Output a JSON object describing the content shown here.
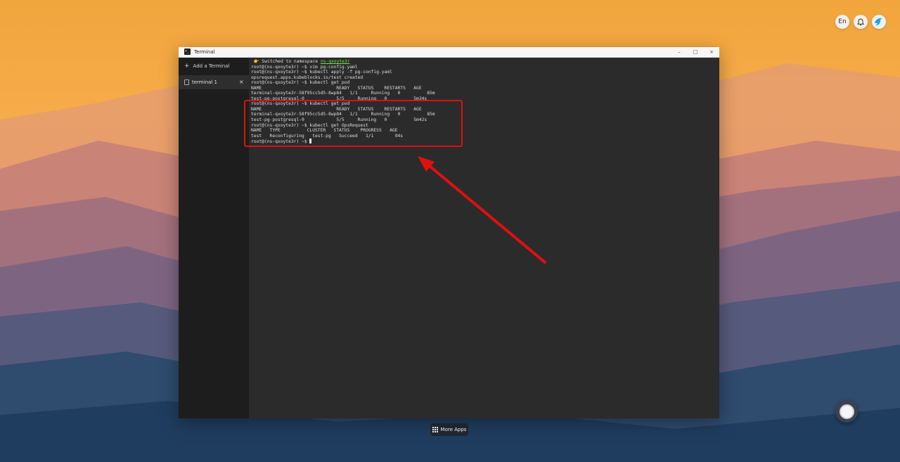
{
  "tray": {
    "language": "En"
  },
  "window": {
    "title": "Terminal",
    "icon_text": ">_",
    "controls": {
      "minimize": "–",
      "maximize": "□",
      "close": "×"
    }
  },
  "sidebar": {
    "add_terminal_label": "Add a Terminal",
    "tabs": [
      {
        "label": "terminal 1",
        "close": "×"
      }
    ]
  },
  "terminal": {
    "switch_prefix": " 👉 Switched to namespace ",
    "namespace": "ns-qxoyte3r",
    "lines": [
      "root@(ns-qxoyte3r) ~$ vim pg-config.yaml",
      "root@(ns-qxoyte3r) ~$ kubectl apply -f pg-config.yaml",
      "opsrequest.apps.kubeblocks.io/test created",
      "root@(ns-qxoyte3r) ~$ kubectl get pod",
      "NAME                            READY   STATUS    RESTARTS   AGE",
      "terminal-qxoyte3r-58f95cc5d5-8wp84   1/1     Running   0          85m",
      "test-pg-postgresql-0            5/5     Running   0          5m34s",
      "root@(ns-qxoyte3r) ~$ kubectl get pod",
      "NAME                            READY   STATUS    RESTARTS   AGE",
      "terminal-qxoyte3r-58f95cc5d5-8wp84   1/1     Running   0          85m",
      "test-pg-postgresql-0            5/5     Running   0          5m42s",
      "root@(ns-qxoyte3r) ~$ kubectl get OpsRequest",
      "NAME   TYPE          CLUSTER   STATUS    PROGRESS   AGE",
      "test   Reconfiguring   test-pg   Succeed   1/1        94s"
    ],
    "prompt": "root@(ns-qxoyte3r) ~$ "
  },
  "dock": {
    "more_apps_label": "More Apps"
  },
  "colors": {
    "annotation": "#e01010",
    "namespace_highlight": "#74e34a",
    "terminal_bg": "#2b2b2b"
  },
  "icons": [
    "terminal-app-icon",
    "plus-icon",
    "terminal-tab-icon",
    "close-icon",
    "minimize-icon",
    "maximize-icon",
    "bell-icon",
    "bird-avatar-icon",
    "apps-grid-icon",
    "assistant-ball-icon"
  ]
}
